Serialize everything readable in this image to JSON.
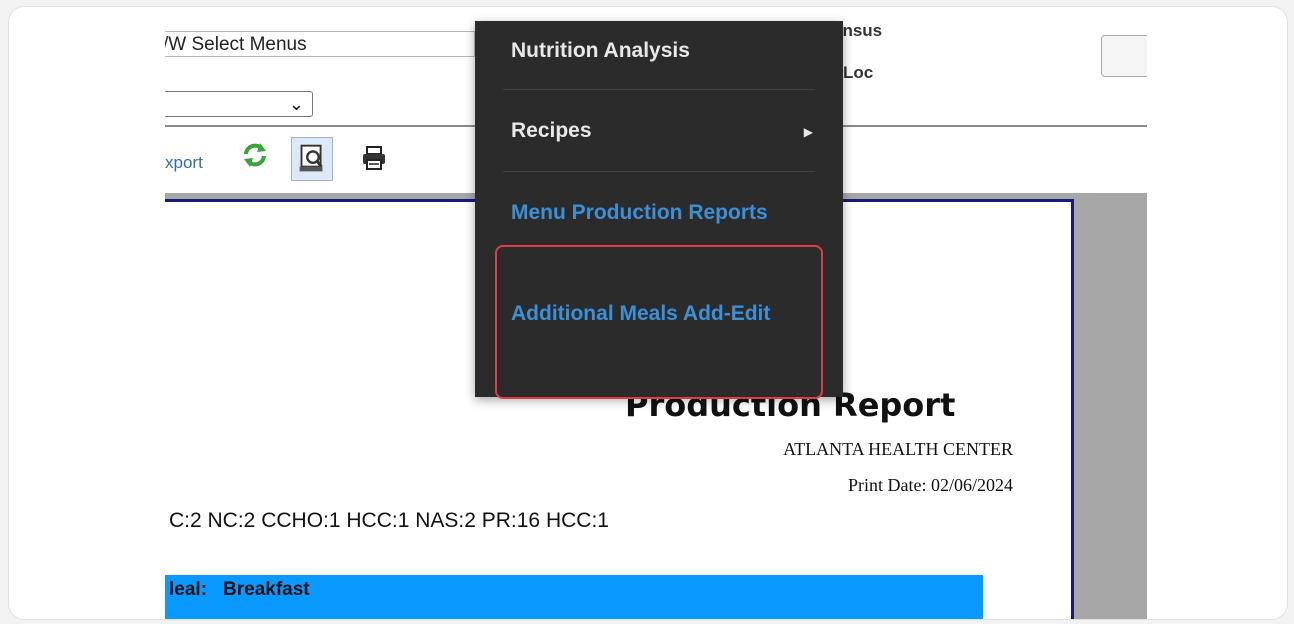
{
  "header": {
    "menu_select_value": "F/W Select Menus",
    "census_label": "Census",
    "loc_label": "Loc"
  },
  "toolbar": {
    "export_label": "Export",
    "icons": [
      "refresh-icon",
      "print-preview-icon",
      "print-icon"
    ]
  },
  "dropdown": {
    "items": [
      {
        "label": "Nutrition Analysis",
        "submenu": false
      },
      {
        "label": "Recipes",
        "submenu": true
      },
      {
        "label": "Menu Production Reports",
        "submenu": false
      },
      {
        "label": "Additional Meals Add-Edit",
        "submenu": false,
        "highlighted": true
      }
    ]
  },
  "report": {
    "title": "Production Report",
    "facility": "ATLANTA HEALTH CENTER",
    "print_date": "Print Date: 02/06/2024",
    "census_codes": "C:2 NC:2 CCHO:1 HCC:1 NAS:2 PR:16 HCC:1",
    "meal_label": "leal:",
    "meal_value": "Breakfast"
  },
  "colors": {
    "menu_bg": "#2b2b2b",
    "menu_link": "#3d8fd6",
    "meal_bar": "#0a99ff",
    "highlight": "#e03b4a"
  }
}
